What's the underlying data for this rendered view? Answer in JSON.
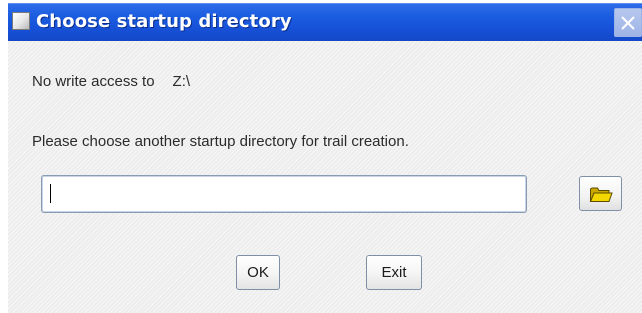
{
  "window": {
    "title": "Choose startup directory",
    "close_icon": "close-x-icon",
    "app_icon": "window-app-icon"
  },
  "message": {
    "no_access_label": "No write access to",
    "no_access_path": "Z:\\",
    "instruction": "Please choose another startup directory for trail creation."
  },
  "directory_input": {
    "value": "",
    "placeholder": ""
  },
  "browse": {
    "icon": "folder-icon"
  },
  "buttons": {
    "ok_label": "OK",
    "exit_label": "Exit"
  },
  "colors": {
    "titlebar": "#1650d6",
    "client_background": "#ededed",
    "folder_yellow": "#e8c400"
  }
}
